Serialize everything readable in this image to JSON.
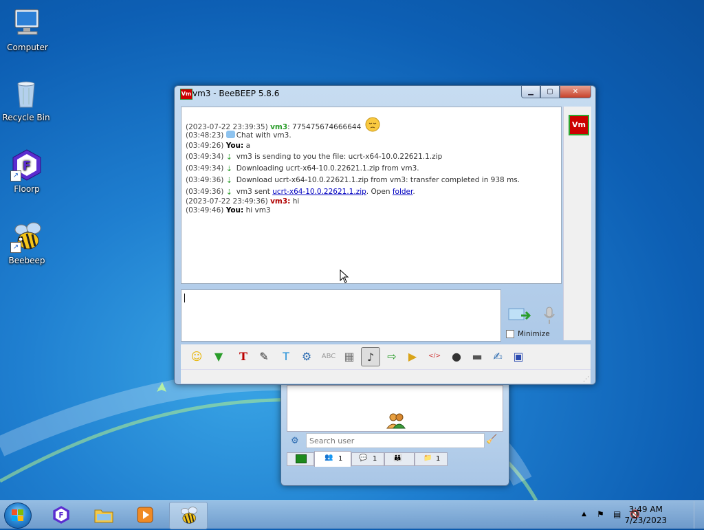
{
  "desktop": {
    "icons": [
      {
        "label": "Computer"
      },
      {
        "label": "Recycle Bin"
      },
      {
        "label": "Floorp"
      },
      {
        "label": "Beebeep"
      }
    ]
  },
  "chat_window": {
    "title": "vm3 - BeeBEEP 5.8.6",
    "logo_text": "Vm",
    "messages": [
      {
        "ts": "(2023-07-22 23:39:35)",
        "name": "vm3",
        "sep": ": ",
        "text": "775475674666644"
      },
      {
        "ts": "(03:48:23)",
        "text": "Chat with vm3."
      },
      {
        "ts": "(03:49:26)",
        "name": "You:",
        "text": " a"
      },
      {
        "ts": "(03:49:34)",
        "text": "vm3 is sending to you the file: ucrt-x64-10.0.22621.1.zip"
      },
      {
        "ts": "(03:49:34)",
        "text": "Downloading ucrt-x64-10.0.22621.1.zip from vm3."
      },
      {
        "ts": "(03:49:36)",
        "text": "Download ucrt-x64-10.0.22621.1.zip from vm3: transfer completed in 938 ms."
      },
      {
        "ts": "(03:49:36)",
        "text_pre": "vm3 sent ",
        "link1": "ucrt-x64-10.0.22621.1.zip",
        "text_mid": ". Open ",
        "link2": "folder",
        "text_post": "."
      },
      {
        "ts": "(2023-07-22 23:49:36)",
        "name": "vm3:",
        "text": " hi"
      },
      {
        "ts": "(03:49:46)",
        "name": "You:",
        "text": " hi vm3"
      }
    ],
    "minimize_label": "Minimize",
    "avatar_text": "Vm"
  },
  "main_window": {
    "search_placeholder": "Search user",
    "tabs": [
      {
        "count": "1"
      },
      {
        "count": "1"
      },
      {
        "count": ""
      },
      {
        "count": "1"
      }
    ]
  },
  "taskbar": {
    "time": "3:49 AM",
    "date": "7/23/2023"
  },
  "colors": {
    "accent_green": "#2a9d2a",
    "accent_red": "#b00000",
    "link_blue": "#0000c0"
  }
}
